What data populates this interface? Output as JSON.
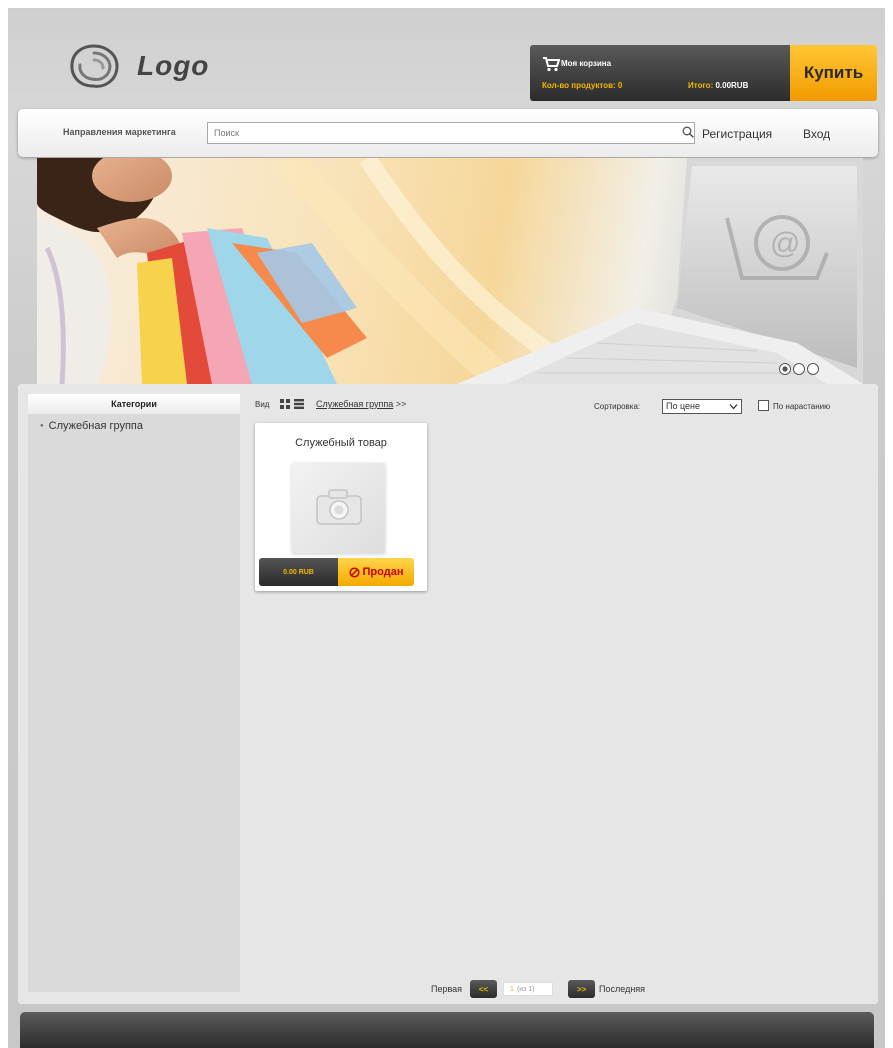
{
  "header": {
    "logo_text": "Logo",
    "cart": {
      "title": "Моя корзина",
      "count_label": "Кол-во продуктов: ",
      "count_value": "0",
      "total_label": "Итого: ",
      "total_value": "0.00RUB"
    },
    "buy_label": "Купить"
  },
  "nav": {
    "section_label": "Направления маркетинга",
    "search_placeholder": "Поиск",
    "register_label": "Регистрация",
    "login_label": "Вход"
  },
  "banner": {
    "slides": 3,
    "active_slide": 1
  },
  "sidebar": {
    "title": "Категории",
    "items": [
      {
        "label": "Служебная группа"
      }
    ]
  },
  "toolbar": {
    "view_label": "Вид",
    "breadcrumb_link": "Служебная группа",
    "breadcrumb_suffix": " >>",
    "sort_label": "Сортировка:",
    "sort_value": "По цене",
    "ascending_label": "По нарастанию"
  },
  "products": [
    {
      "name": "Служебный товар",
      "price": "0.00 RUB",
      "status": "Продан"
    }
  ],
  "pagination": {
    "first_label": "Первая",
    "last_label": "Последняя",
    "prev_label": "<<",
    "next_label": ">>",
    "current_page": "1",
    "page_of": "(из 1)"
  },
  "colors": {
    "accent": "#f5b700",
    "dark": "#2b2b2b",
    "panel": "#e6e6e6"
  }
}
